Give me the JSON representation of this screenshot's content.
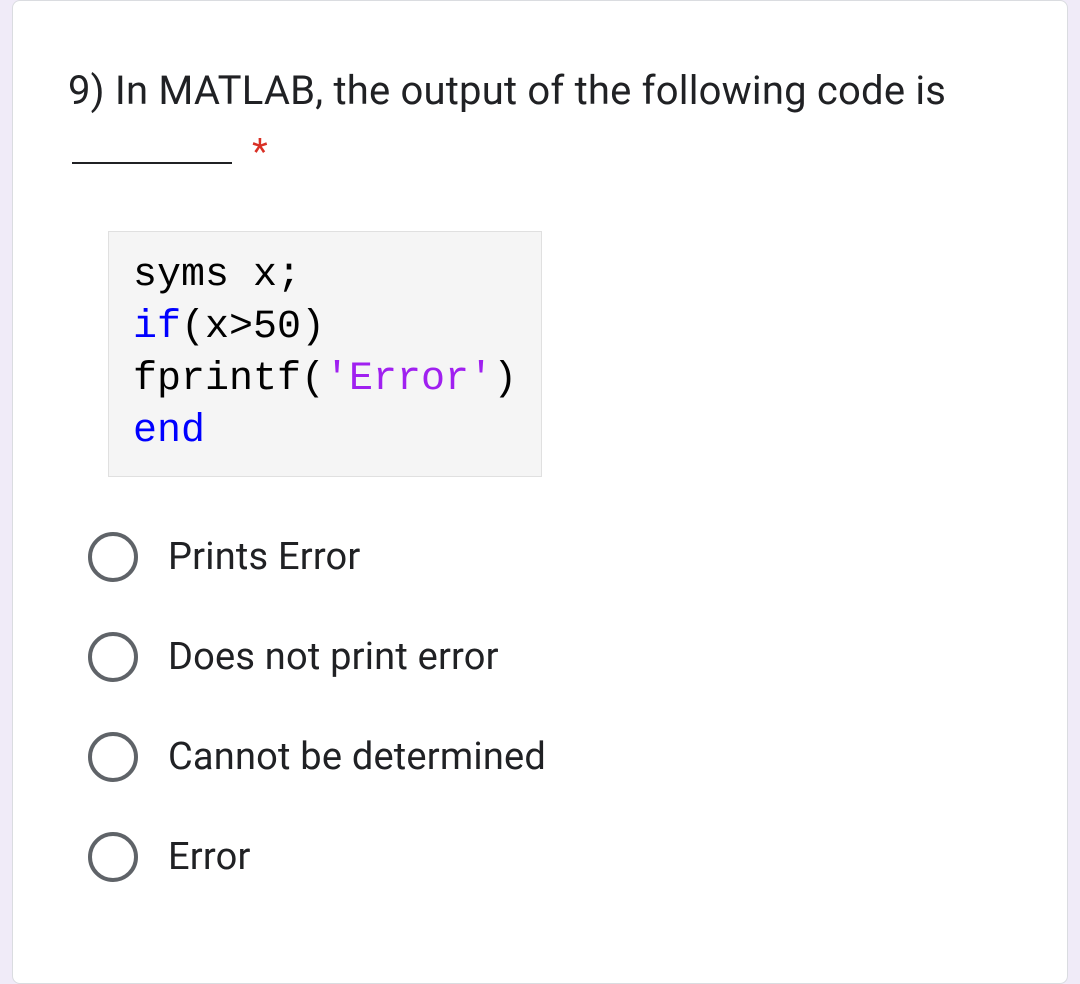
{
  "question": {
    "prefix": "9) In MATLAB, the output of the following code is",
    "required_marker": "*"
  },
  "code": {
    "line1_a": "syms",
    "line1_b": " x;",
    "line2_a": "if",
    "line2_b": "(x>50)",
    "line3_a": "fprintf(",
    "line3_b": "'Error'",
    "line3_c": ")",
    "line4": "end"
  },
  "options": [
    {
      "label": "Prints Error"
    },
    {
      "label": "Does not print error"
    },
    {
      "label": "Cannot be determined"
    },
    {
      "label": "Error"
    }
  ]
}
